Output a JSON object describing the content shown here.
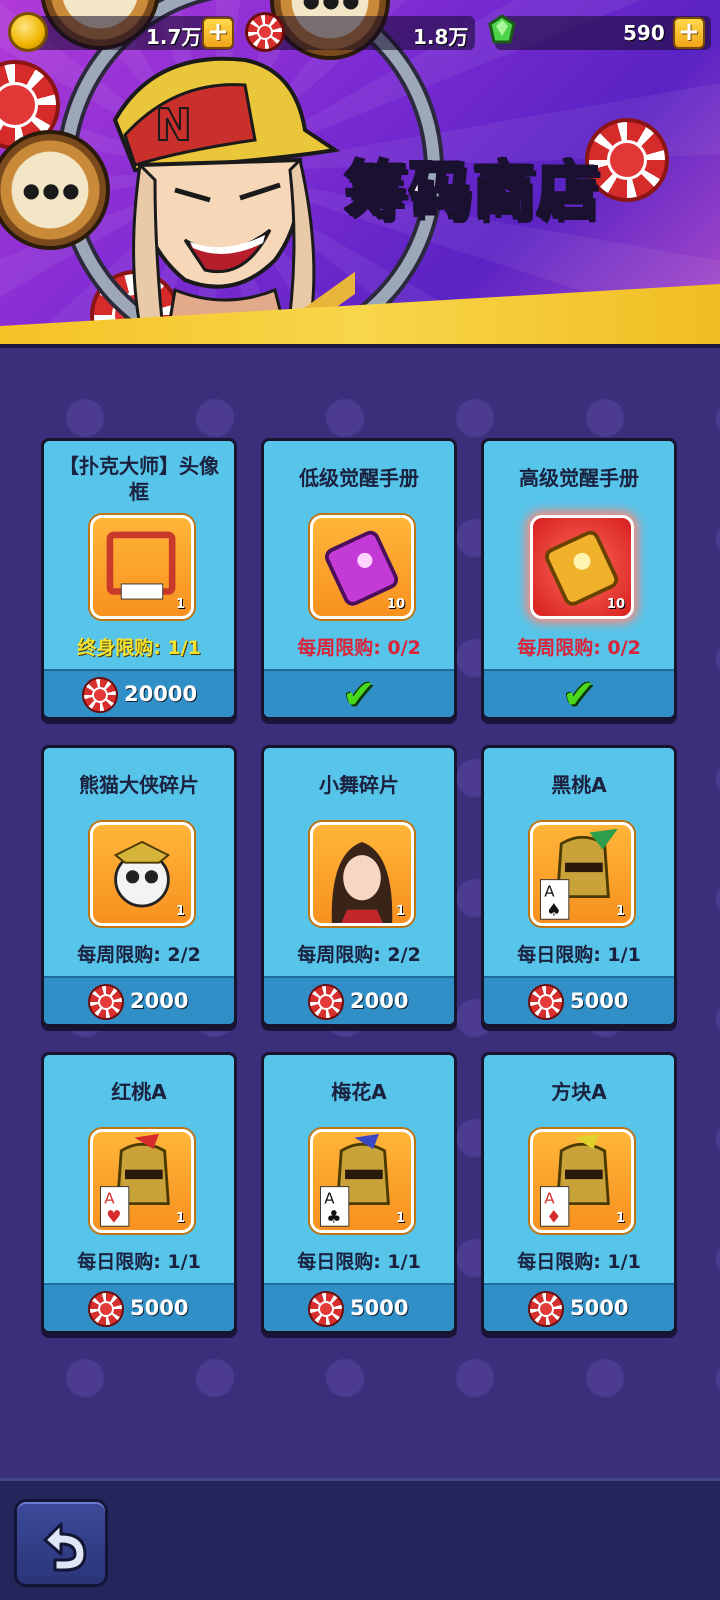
{
  "currencies": {
    "coins": {
      "value": "1.7万",
      "icon": "coin-icon"
    },
    "chips": {
      "value": "1.8万",
      "icon": "chip-icon"
    },
    "gems": {
      "value": "590",
      "icon": "gem-icon"
    },
    "plus_label": "+"
  },
  "banner": {
    "title": "筹码商店"
  },
  "items": [
    {
      "name": "【扑克大师】头像框",
      "qty": "1",
      "limit": "终身限购: 1/1",
      "price": "20000",
      "purchased": false
    },
    {
      "name": "低级觉醒手册",
      "qty": "10",
      "limit": "每周限购: 0/2",
      "price": "",
      "purchased": true
    },
    {
      "name": "高级觉醒手册",
      "qty": "10",
      "limit": "每周限购: 0/2",
      "price": "",
      "purchased": true
    },
    {
      "name": "熊猫大侠碎片",
      "qty": "1",
      "limit": "每周限购: 2/2",
      "price": "2000",
      "purchased": false
    },
    {
      "name": "小舞碎片",
      "qty": "1",
      "limit": "每周限购: 2/2",
      "price": "2000",
      "purchased": false
    },
    {
      "name": "黑桃A",
      "qty": "1",
      "limit": "每日限购: 1/1",
      "price": "5000",
      "purchased": false
    },
    {
      "name": "红桃A",
      "qty": "1",
      "limit": "每日限购: 1/1",
      "price": "5000",
      "purchased": false
    },
    {
      "name": "梅花A",
      "qty": "1",
      "limit": "每日限购: 1/1",
      "price": "5000",
      "purchased": false
    },
    {
      "name": "方块A",
      "qty": "1",
      "limit": "每日限购: 1/1",
      "price": "5000",
      "purchased": false
    }
  ],
  "check_mark": "✔",
  "colors": {
    "card_bg": "#57c4ea",
    "footer_bg": "#2f8fc6",
    "limit_gold": "#f3e132",
    "limit_red": "#d8253a"
  }
}
